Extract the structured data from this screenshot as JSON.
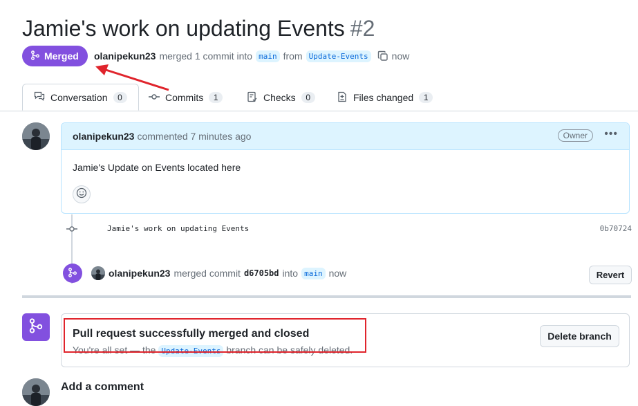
{
  "header": {
    "title": "Jamie's work on updating Events",
    "number": "#2",
    "state_label": "Merged",
    "author": "olanipekun23",
    "merged_text": "merged 1 commit into",
    "base_branch": "main",
    "from_text": "from",
    "head_branch": "Update-Events",
    "time": "now"
  },
  "tabs": [
    {
      "label": "Conversation",
      "count": "0"
    },
    {
      "label": "Commits",
      "count": "1"
    },
    {
      "label": "Checks",
      "count": "0"
    },
    {
      "label": "Files changed",
      "count": "1"
    }
  ],
  "comment": {
    "author": "olanipekun23",
    "action": "commented 7 minutes ago",
    "role": "Owner",
    "body": "Jamie's Update on Events located here"
  },
  "commit": {
    "message": "Jamie's work on updating Events",
    "sha": "0b70724"
  },
  "merge_event": {
    "author": "olanipekun23",
    "text": "merged commit",
    "sha": "d6705bd",
    "into": "into",
    "branch": "main",
    "time": "now",
    "revert_label": "Revert"
  },
  "merge_status": {
    "title": "Pull request successfully merged and closed",
    "sub_before": "You're all set — the",
    "branch": "Update-Events",
    "sub_after": "branch can be safely deleted.",
    "delete_label": "Delete branch"
  },
  "add_comment": {
    "label": "Add a comment"
  },
  "colors": {
    "merged_purple": "#8250df",
    "annotation_red": "#e0242c",
    "link_blue": "#0969da"
  }
}
